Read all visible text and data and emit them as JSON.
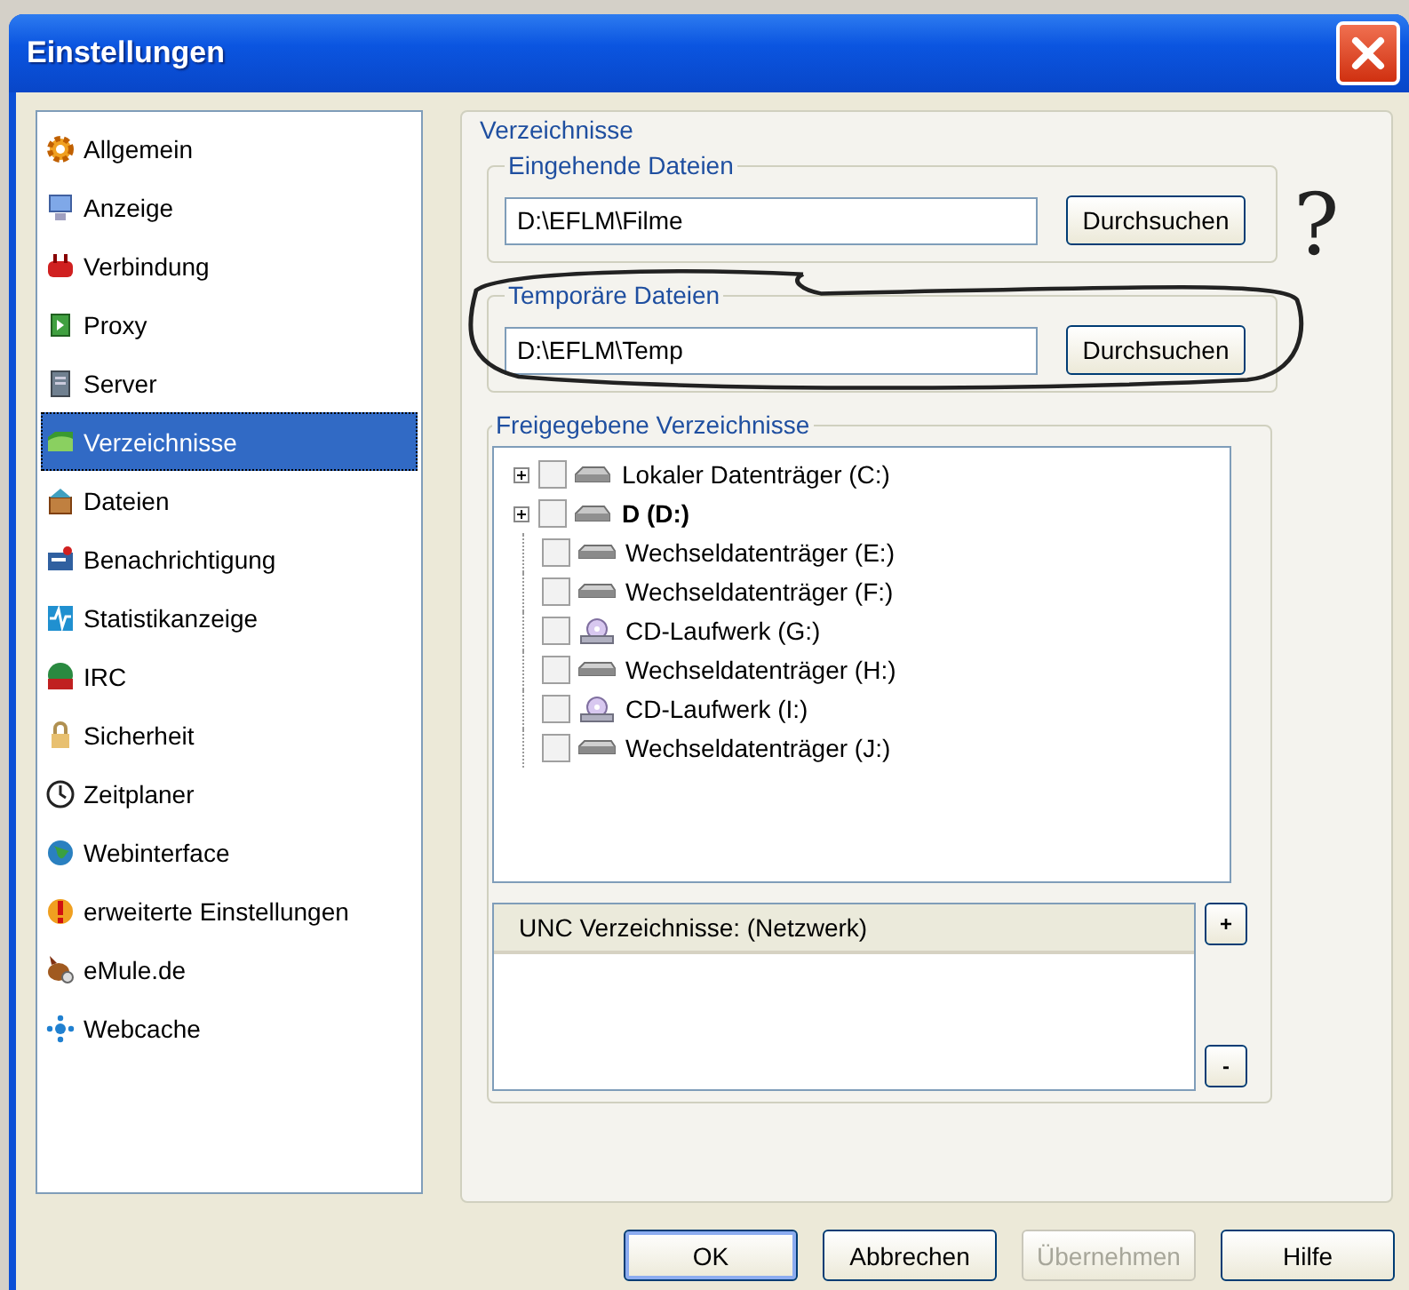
{
  "window": {
    "title": "Einstellungen"
  },
  "sidebar": {
    "items": [
      {
        "label": "Allgemein",
        "selected": false
      },
      {
        "label": "Anzeige",
        "selected": false
      },
      {
        "label": "Verbindung",
        "selected": false
      },
      {
        "label": "Proxy",
        "selected": false
      },
      {
        "label": "Server",
        "selected": false
      },
      {
        "label": "Verzeichnisse",
        "selected": true
      },
      {
        "label": "Dateien",
        "selected": false
      },
      {
        "label": "Benachrichtigung",
        "selected": false
      },
      {
        "label": "Statistikanzeige",
        "selected": false
      },
      {
        "label": "IRC",
        "selected": false
      },
      {
        "label": "Sicherheit",
        "selected": false
      },
      {
        "label": "Zeitplaner",
        "selected": false
      },
      {
        "label": "Webinterface",
        "selected": false
      },
      {
        "label": "erweiterte Einstellungen",
        "selected": false
      },
      {
        "label": "eMule.de",
        "selected": false
      },
      {
        "label": "Webcache",
        "selected": false
      }
    ]
  },
  "panel": {
    "title": "Verzeichnisse",
    "incoming": {
      "label": "Eingehende Dateien",
      "value": "D:\\EFLM\\Filme",
      "button": "Durchsuchen"
    },
    "temp": {
      "label": "Temporäre Dateien",
      "value": "D:\\EFLM\\Temp",
      "button": "Durchsuchen"
    },
    "shared": {
      "label": "Freigegebene Verzeichnisse",
      "tree": [
        {
          "label": "Lokaler Datenträger (C:)",
          "kind": "hdd",
          "expandable": true,
          "checked": false,
          "bold": false
        },
        {
          "label": "D (D:)",
          "kind": "hdd",
          "expandable": true,
          "checked": false,
          "bold": true
        },
        {
          "label": "Wechseldatenträger (E:)",
          "kind": "removable",
          "expandable": false,
          "checked": false,
          "bold": false
        },
        {
          "label": "Wechseldatenträger (F:)",
          "kind": "removable",
          "expandable": false,
          "checked": false,
          "bold": false
        },
        {
          "label": "CD-Laufwerk (G:)",
          "kind": "cd",
          "expandable": false,
          "checked": false,
          "bold": false
        },
        {
          "label": "Wechseldatenträger (H:)",
          "kind": "removable",
          "expandable": false,
          "checked": false,
          "bold": false
        },
        {
          "label": "CD-Laufwerk (I:)",
          "kind": "cd",
          "expandable": false,
          "checked": false,
          "bold": false
        },
        {
          "label": "Wechseldatenträger (J:)",
          "kind": "removable",
          "expandable": false,
          "checked": false,
          "bold": false
        }
      ],
      "unc": {
        "column": "UNC Verzeichnisse: (Netzwerk)",
        "add": "+",
        "remove": "-"
      }
    }
  },
  "annotation": {
    "mark": "?"
  },
  "buttons": [
    {
      "label": "OK",
      "disabled": false,
      "default": true
    },
    {
      "label": "Abbrechen",
      "disabled": false,
      "default": false
    },
    {
      "label": "Übernehmen",
      "disabled": true,
      "default": false
    },
    {
      "label": "Hilfe",
      "disabled": false,
      "default": false
    }
  ]
}
